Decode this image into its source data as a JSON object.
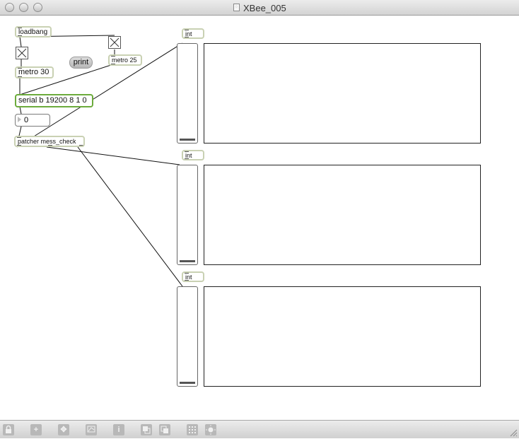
{
  "window": {
    "title": "XBee_005"
  },
  "objects": {
    "loadbang": "loadbang",
    "metro30": "metro 30",
    "metro25": "metro 25",
    "print": "print",
    "serial": "serial b 19200 8 1 0",
    "number_value": "0",
    "patcher": "patcher mess_check",
    "int_labels": [
      "int",
      "int",
      "int"
    ]
  },
  "sliders": [
    {
      "value": 0
    },
    {
      "value": 0
    },
    {
      "value": 0
    }
  ],
  "icons": {
    "toolbar": [
      "lock-icon",
      "add-object-icon",
      "move-icon",
      "presentation-icon",
      "inspector-icon",
      "subpatch-back-icon",
      "subpatch-front-icon",
      "grid-icon",
      "snap-icon"
    ]
  },
  "colors": {
    "box_border": "#c9d1b3",
    "serial_border": "#6cab3c"
  }
}
